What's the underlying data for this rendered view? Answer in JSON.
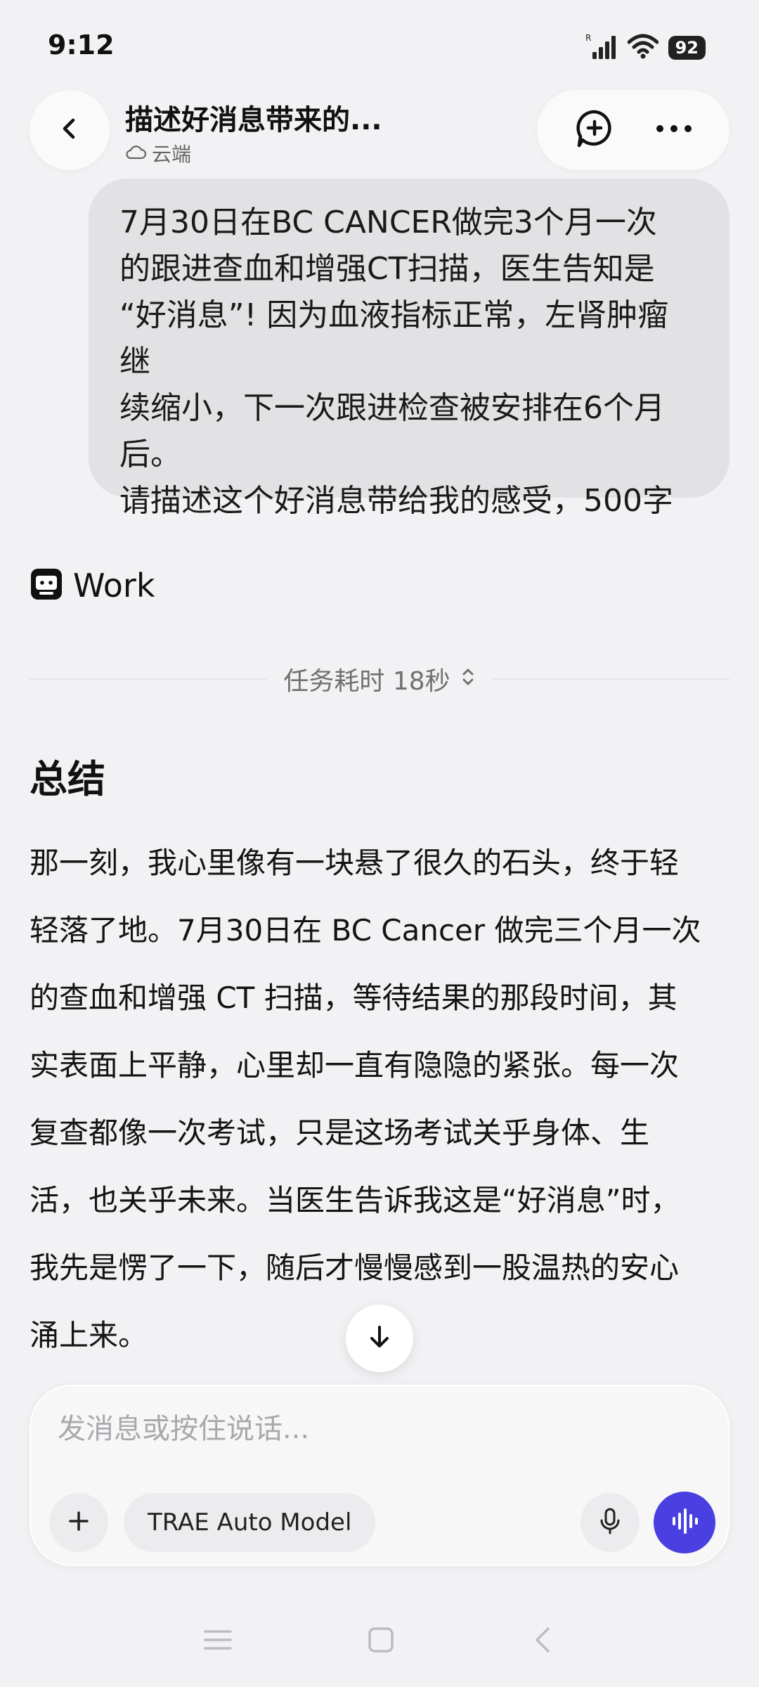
{
  "status_bar": {
    "time": "9:12",
    "battery": "92",
    "signal_label": "R"
  },
  "header": {
    "title": "描述好消息带来的...",
    "subtitle": "云端"
  },
  "user_message": {
    "lines": [
      "7月30日在BC CANCER做完3个月一次",
      "的跟进查血和增强CT扫描，医生告知是",
      "“好消息”! 因为血液指标正常，左肾肿瘤继",
      "续缩小，下一次跟进检查被安排在6个月",
      "后。",
      "请描述这个好消息带给我的感受，500字"
    ]
  },
  "agent": {
    "name": "Work"
  },
  "task": {
    "time_label": "任务耗时 18秒"
  },
  "summary": {
    "heading": "总结",
    "lines": [
      "那一刻，我心里像有一块悬了很久的石头，终于轻",
      "轻落了地。7月30日在 BC Cancer 做完三个月一次",
      "的查血和增强 CT 扫描，等待结果的那段时间，其",
      "实表面上平静，心里却一直有隐隐的紧张。每一次",
      "复查都像一次考试，只是这场考试关乎身体、生",
      "活，也关乎未来。当医生告诉我这是“好消息”时，",
      "我先是愣了一下，随后才慢慢感到一股温热的安心",
      "涌上来。"
    ]
  },
  "composer": {
    "placeholder": "发消息或按住说话...",
    "value": "",
    "model_label": "TRAE Auto Model"
  },
  "colors": {
    "accent": "#4a3fe0",
    "background": "#f2f2f4",
    "user_bubble": "#e2e2e4"
  }
}
